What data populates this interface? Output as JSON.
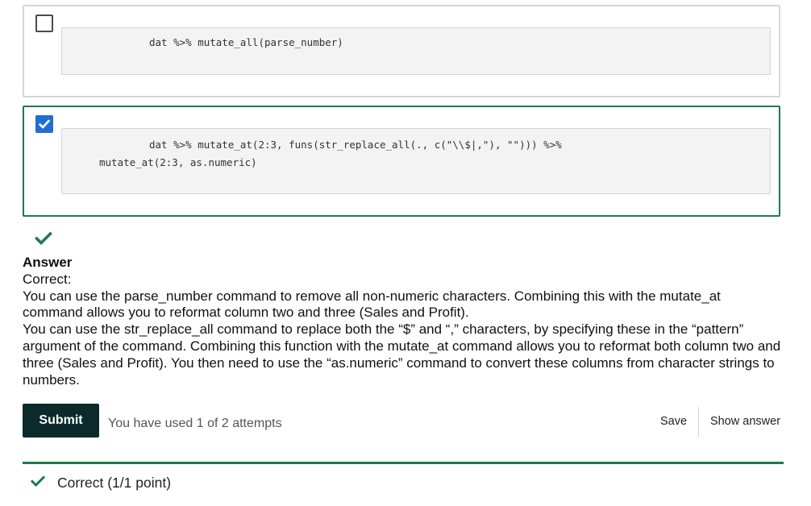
{
  "options": [
    {
      "checked": false,
      "code_lines": [
        "dat %>% mutate_all(parse_number)"
      ]
    },
    {
      "checked": true,
      "code_lines": [
        "dat %>% mutate_at(2:3, funs(str_replace_all(., c(\"\\\\$|,\"), \"\"))) %>%",
        "mutate_at(2:3, as.numeric)"
      ]
    }
  ],
  "answer": {
    "title": "Answer",
    "verdict": "Correct:",
    "paragraph1": "You can use the parse_number command to remove all non-numeric characters. Combining this with the mutate_at command allows you to reformat column two and three (Sales and Profit).",
    "paragraph2": "You can use the str_replace_all command to replace both the “$” and “,” characters, by specifying these in the “pattern” argument of the command. Combining this function with the mutate_at command allows you to reformat both column two and three (Sales and Profit). You then need to use the “as.numeric” command to convert these columns from character strings to numbers."
  },
  "actions": {
    "submit_label": "Submit",
    "attempts_text": "You have used 1 of 2 attempts",
    "save_label": "Save",
    "show_answer_label": "Show answer"
  },
  "status": {
    "text": "Correct (1/1 point)"
  },
  "colors": {
    "correct_green": "#1f7a4c",
    "checkbox_blue": "#1f6fd1",
    "submit_bg": "#0b2a2c"
  },
  "icons": {
    "result": "checkmark-icon",
    "checkbox_checked": "checkbox-checked-icon"
  }
}
